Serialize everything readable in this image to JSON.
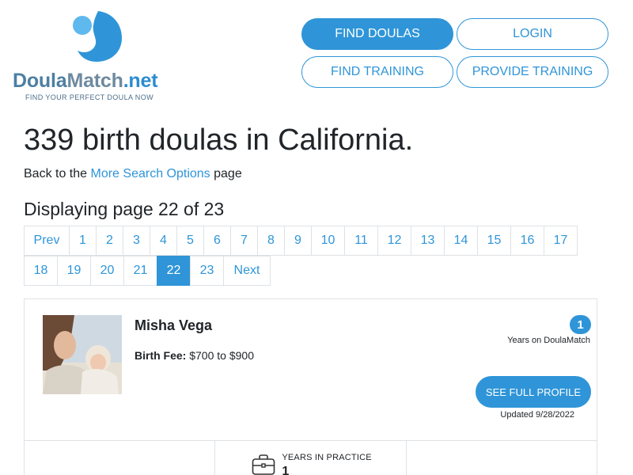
{
  "brand": {
    "name_part1": "Doula",
    "name_part2": "Match",
    "name_part3": ".net",
    "tagline": "FIND YOUR PERFECT DOULA NOW",
    "colors": {
      "primary": "#2f95d8",
      "dark_blue": "#4d7fa3"
    }
  },
  "nav": {
    "find_doulas": "FIND DOULAS",
    "login": "LOGIN",
    "find_training": "FIND TRAINING",
    "provide_training": "PROVIDE TRAINING"
  },
  "page": {
    "heading": "339 birth doulas in California.",
    "back_prefix": "Back to the ",
    "back_link": "More Search Options",
    "back_suffix": " page",
    "subheading": "Displaying page 22 of 23"
  },
  "pagination": {
    "prev_label": "Prev",
    "next_label": "Next",
    "current_page": 22,
    "total_pages": 23
  },
  "results": [
    {
      "name": "Misha Vega",
      "fee_label": "Birth Fee:",
      "fee_value": " $700 to $900",
      "years_on_site": "1",
      "years_caption": "Years on DoulaMatch",
      "profile_button": "SEE FULL PROFILE",
      "updated": "Updated 9/28/2022",
      "years_practice_label": "YEARS IN PRACTICE",
      "years_practice_value": "1",
      "icon": "briefcase-icon"
    }
  ]
}
